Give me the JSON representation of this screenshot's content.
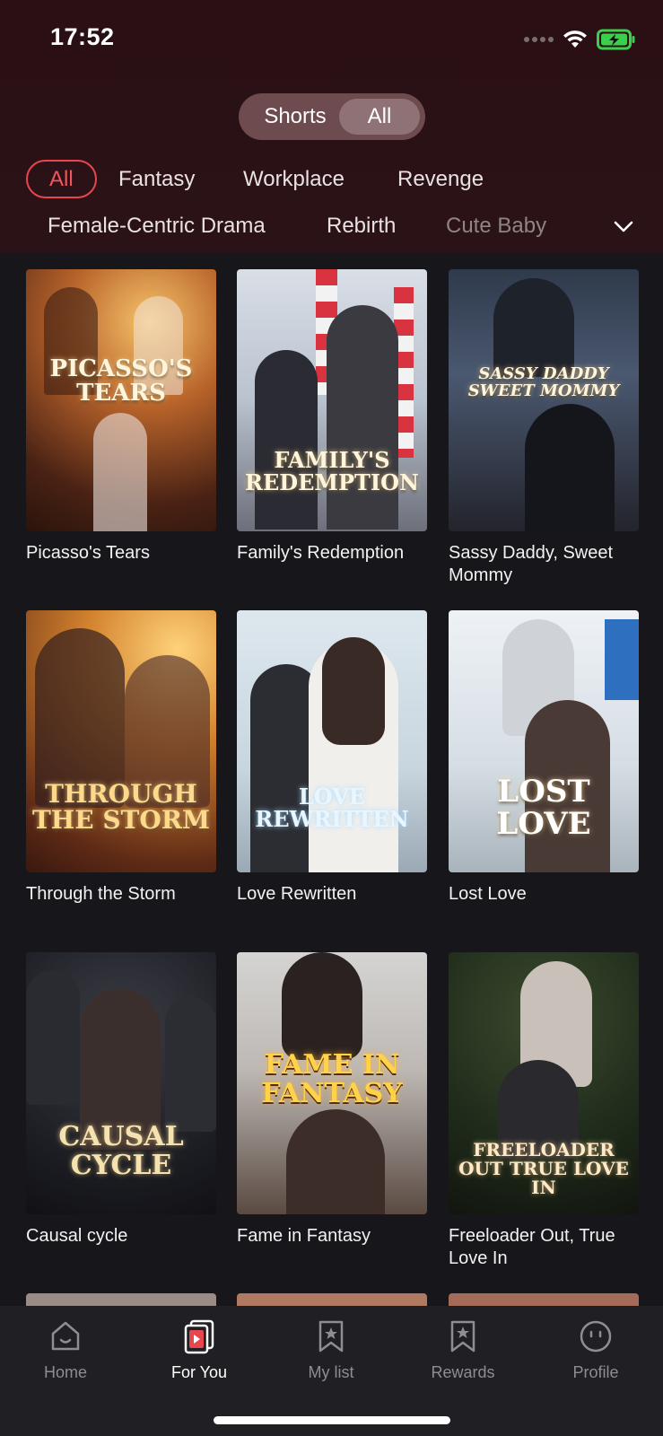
{
  "status": {
    "time": "17:52"
  },
  "toggle": {
    "shorts": "Shorts",
    "all": "All"
  },
  "categories": [
    "All",
    "Fantasy",
    "Workplace",
    "Revenge",
    "Female-Centric Drama",
    "Rebirth",
    "Cute Baby"
  ],
  "dramas": [
    {
      "title": "Picasso's Tears",
      "poster_text": "PICASSO'S TEARS"
    },
    {
      "title": "Family's Redemption",
      "poster_text": "FAMILY'S REDEMPTION"
    },
    {
      "title": "Sassy Daddy, Sweet Mommy",
      "poster_text": "SASSY DADDY SWEET MOMMY"
    },
    {
      "title": "Through the Storm",
      "poster_text": "THROUGH THE STORM"
    },
    {
      "title": "Love Rewritten",
      "poster_text": "LOVE REWRITTEN"
    },
    {
      "title": "Lost Love",
      "poster_text": "LOST LOVE"
    },
    {
      "title": "Causal cycle",
      "poster_text": "CAUSAL CYCLE"
    },
    {
      "title": "Fame in Fantasy",
      "poster_text": "FAME IN FANTASY"
    },
    {
      "title": "Freeloader Out, True Love In",
      "poster_text": "FREELOADER OUT TRUE LOVE IN"
    }
  ],
  "nav": {
    "home": "Home",
    "for_you": "For You",
    "my_list": "My list",
    "rewards": "Rewards",
    "profile": "Profile"
  },
  "colors": {
    "accent": "#f0565d",
    "header_bg": "#2a1014",
    "page_bg": "#17161a"
  }
}
